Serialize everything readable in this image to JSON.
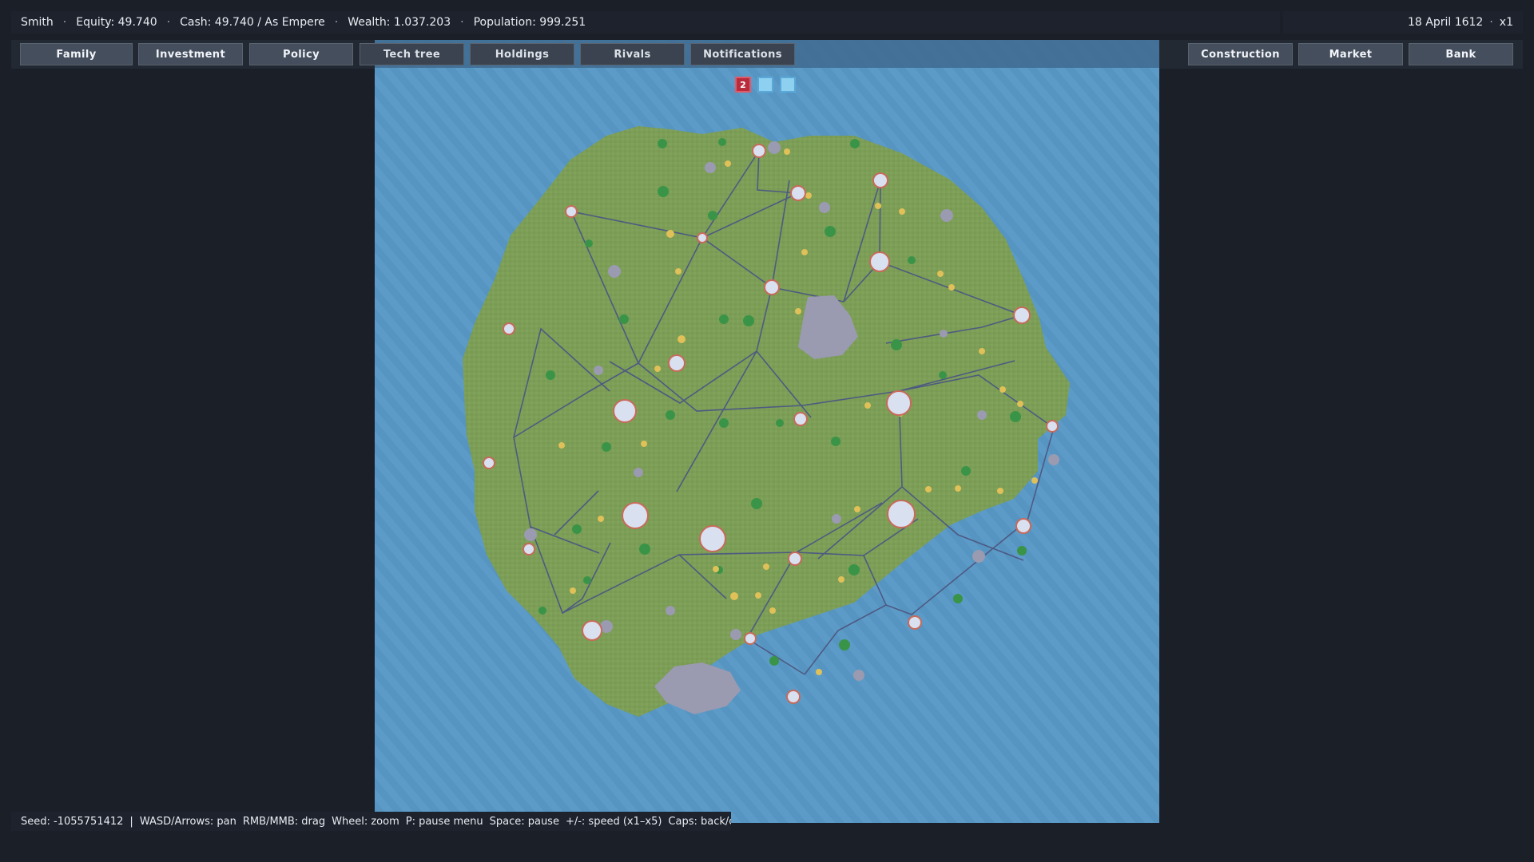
{
  "status": {
    "name": "Smith",
    "equity": "Equity: 49.740",
    "cash": "Cash: 49.740 / As Empere",
    "wealth": "Wealth: 1.037.203",
    "population": "Population: 999.251",
    "separator": "·",
    "date": "18 April 1612",
    "speed": "x1"
  },
  "nav": {
    "family": "Family",
    "investment": "Investment",
    "policy": "Policy",
    "tech_tree": "Tech tree",
    "holdings": "Holdings",
    "rivals": "Rivals",
    "notifications": "Notifications",
    "construction": "Construction",
    "market": "Market",
    "bank": "Bank"
  },
  "map": {
    "page_indicator": "2",
    "colors": {
      "ocean": "#5694c2",
      "land": "#7c9e56",
      "settlement": "#d9e0f0",
      "settlement_border": "#c86a5a",
      "road": "#4e5a82",
      "forest": "#3a9448",
      "mountain": "#9a9ab0",
      "farmland": "#e0c058"
    }
  },
  "footer": {
    "seed": "Seed: -1055751412",
    "divider": "|",
    "pan": "WASD/Arrows: pan",
    "drag": "RMB/MMB: drag",
    "zoom": "Wheel: zoom",
    "pause_menu": "P: pause menu",
    "pause": "Space: pause",
    "speed": "+/-: speed (x1–x5)",
    "back": "Caps: back/clos..."
  }
}
